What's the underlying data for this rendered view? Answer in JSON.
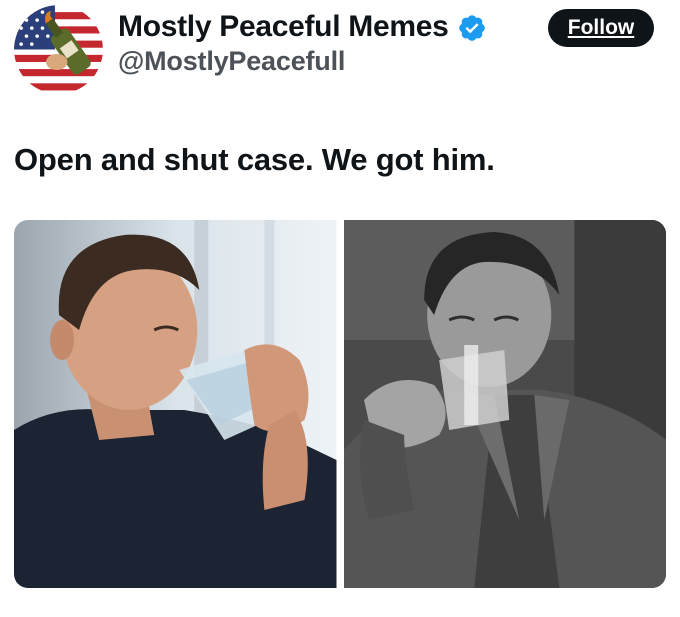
{
  "post": {
    "author": {
      "display_name": "Mostly Peaceful Memes",
      "handle": "@MostlyPeacefull",
      "verified": true,
      "avatar_icon": "flag-bottle-avatar"
    },
    "follow_label": "Follow",
    "text": "Open and shut case. We got him.",
    "media": [
      {
        "icon": "color-photo-man-drinking-water"
      },
      {
        "icon": "bw-photo-man-drinking-water"
      }
    ]
  },
  "colors": {
    "text_primary": "#0f1419",
    "text_secondary": "#4d5258",
    "verified_blue": "#1d9bf0",
    "button_bg": "#0f1419",
    "button_text": "#ffffff"
  }
}
